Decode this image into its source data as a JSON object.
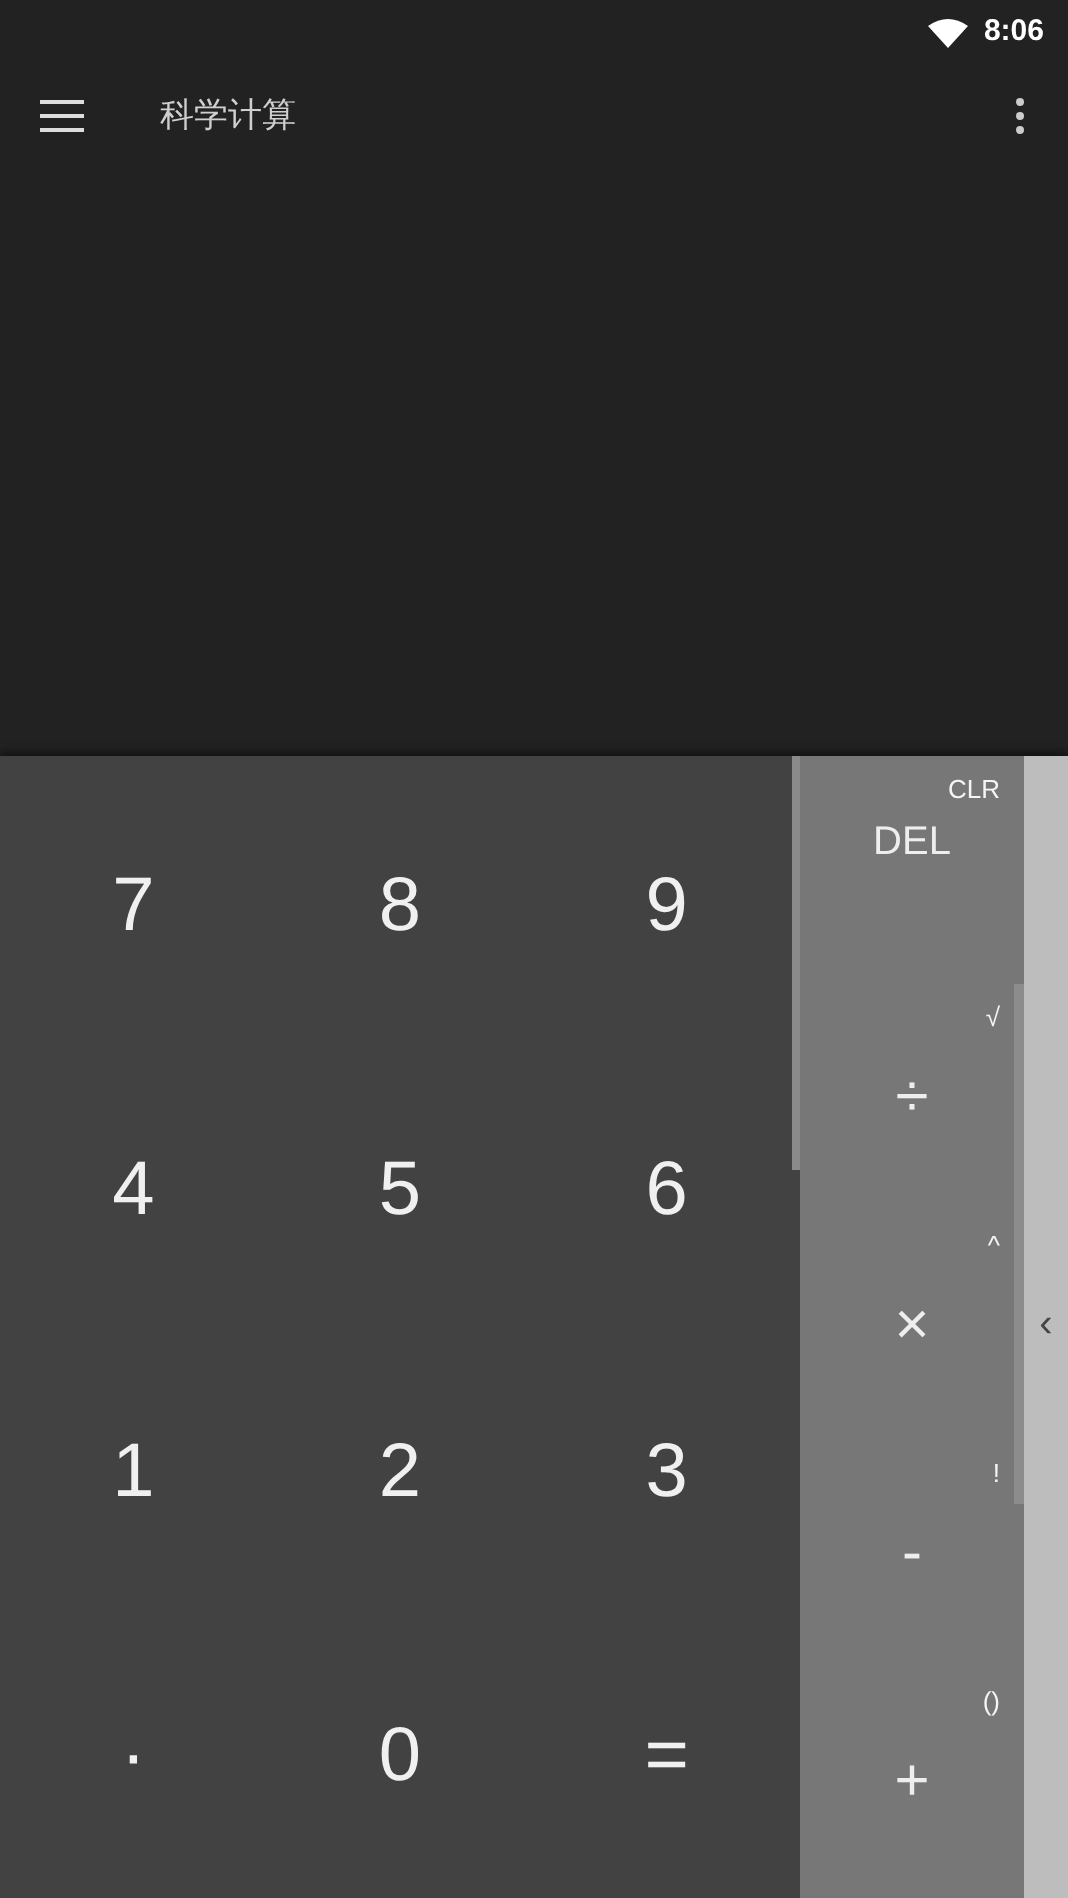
{
  "status_bar": {
    "time": "8:06"
  },
  "toolbar": {
    "title": "科学计算"
  },
  "digits": [
    {
      "label": "7"
    },
    {
      "label": "8"
    },
    {
      "label": "9"
    },
    {
      "label": "4"
    },
    {
      "label": "5"
    },
    {
      "label": "6"
    },
    {
      "label": "1"
    },
    {
      "label": "2"
    },
    {
      "label": "3"
    },
    {
      "label": "·"
    },
    {
      "label": "0"
    },
    {
      "label": "="
    }
  ],
  "operators": [
    {
      "label": "DEL",
      "secondary": "CLR"
    },
    {
      "label": "÷",
      "secondary": "√"
    },
    {
      "label": "×",
      "secondary": "^"
    },
    {
      "label": "-",
      "secondary": "!"
    },
    {
      "label": "+",
      "secondary": "()"
    }
  ],
  "side_panel": {
    "handle": "‹"
  }
}
